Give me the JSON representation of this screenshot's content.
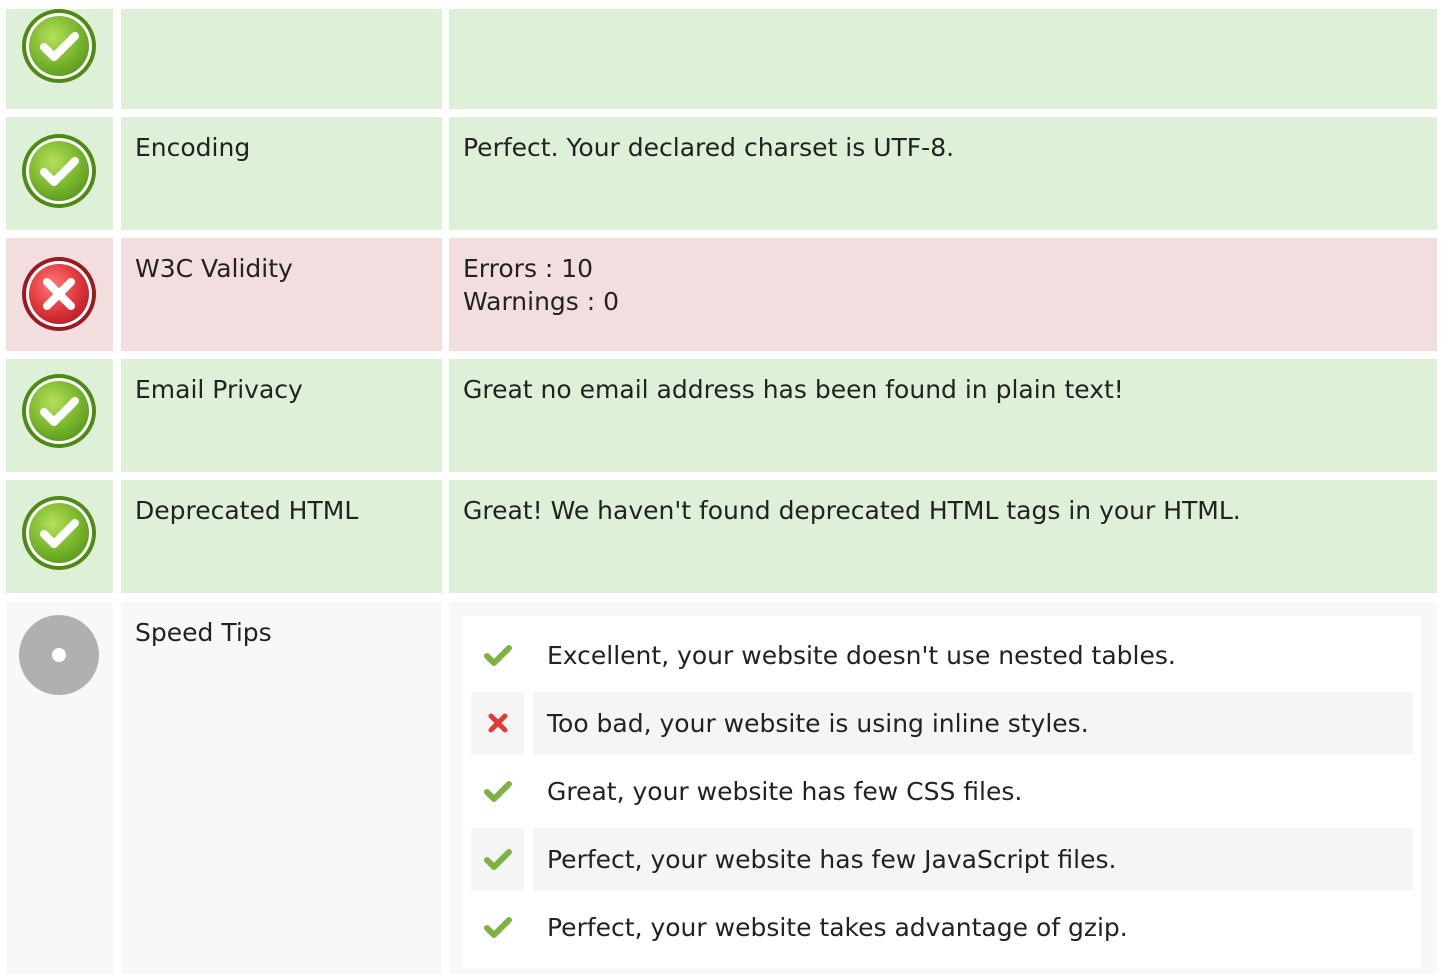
{
  "colors": {
    "pass_row": "#dff0d8",
    "fail_row": "#f2dede",
    "neutral_row": "#f8f8f8",
    "pass_icon": "#7cb82f",
    "fail_icon": "#e0393e",
    "neutral_icon": "#b0b0b0",
    "tip_check": "#7cb342",
    "tip_cross": "#e53935"
  },
  "rows": [
    {
      "status": "pass",
      "icon": "check-circle-icon",
      "label": "",
      "value_lines": []
    },
    {
      "status": "pass",
      "icon": "check-circle-icon",
      "label": "Encoding",
      "value_lines": [
        "Perfect. Your declared charset is UTF-8."
      ]
    },
    {
      "status": "fail",
      "icon": "error-circle-icon",
      "label": "W3C Validity",
      "value_lines": [
        "Errors : 10",
        "Warnings : 0"
      ]
    },
    {
      "status": "pass",
      "icon": "check-circle-icon",
      "label": "Email Privacy",
      "value_lines": [
        "Great no email address has been found in plain text!"
      ]
    },
    {
      "status": "pass",
      "icon": "check-circle-icon",
      "label": "Deprecated HTML",
      "value_lines": [
        "Great! We haven't found deprecated HTML tags in your HTML."
      ]
    }
  ],
  "speed_tips": {
    "status": "neutral",
    "icon": "info-circle-icon",
    "label": "Speed Tips",
    "items": [
      {
        "status": "pass",
        "icon": "check-icon",
        "text": "Excellent, your website doesn't use nested tables."
      },
      {
        "status": "fail",
        "icon": "cross-icon",
        "text": "Too bad, your website is using inline styles."
      },
      {
        "status": "pass",
        "icon": "check-icon",
        "text": "Great, your website has few CSS files."
      },
      {
        "status": "pass",
        "icon": "check-icon",
        "text": "Perfect, your website has few JavaScript files."
      },
      {
        "status": "pass",
        "icon": "check-icon",
        "text": "Perfect, your website takes advantage of gzip."
      }
    ]
  }
}
